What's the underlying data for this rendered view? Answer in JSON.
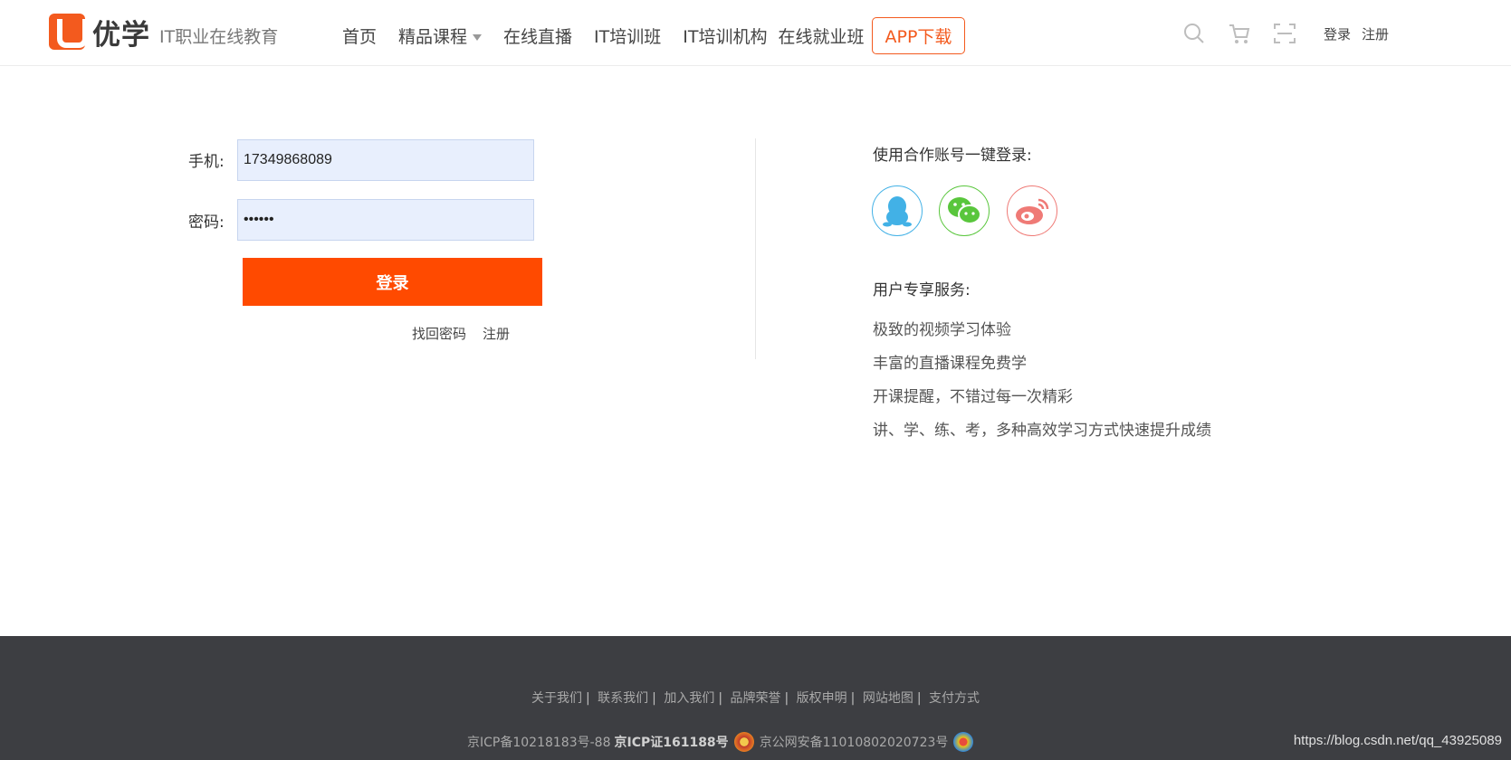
{
  "header": {
    "logo_name": "优学",
    "logo_slogan": "IT职业在线教育",
    "nav": [
      "首页",
      "精品课程",
      "在线直播",
      "IT培训班",
      "IT培训机构",
      "在线就业班"
    ],
    "app_button": "APP下载",
    "icons": [
      "search-icon",
      "cart-icon",
      "scan-icon"
    ],
    "login_link": "登录",
    "register_link": "注册"
  },
  "login": {
    "phone_label": "手机:",
    "phone_value": "17349868089",
    "password_label": "密码:",
    "password_value": "••••••",
    "submit_label": "登录",
    "forgot_link": "找回密码",
    "register_link": "注册"
  },
  "right": {
    "partner_title": "使用合作账号一键登录:",
    "social": [
      {
        "name": "qq-icon",
        "color": "#42b1e6"
      },
      {
        "name": "wechat-icon",
        "color": "#59c63c"
      },
      {
        "name": "weibo-icon",
        "color": "#ef7a76"
      }
    ],
    "service_title": "用户专享服务:",
    "features": [
      "极致的视频学习体验",
      "丰富的直播课程免费学",
      "开课提醒，不错过每一次精彩",
      "讲、学、练、考，多种高效学习方式快速提升成绩"
    ]
  },
  "footer": {
    "links": [
      "关于我们",
      "联系我们",
      "加入我们",
      "品牌荣誉",
      "版权申明",
      "网站地图",
      "支付方式"
    ],
    "icp1": "京ICP备10218183号-88",
    "icp2": "京ICP证161188号",
    "police": "京公网安备11010802020723号",
    "watermark": "https://blog.csdn.net/qq_43925089"
  },
  "colors": {
    "accent": "#f35a1e",
    "login_button": "#ff4a00",
    "input_bg": "#e8effd",
    "footer_bg": "#3d3e42"
  }
}
